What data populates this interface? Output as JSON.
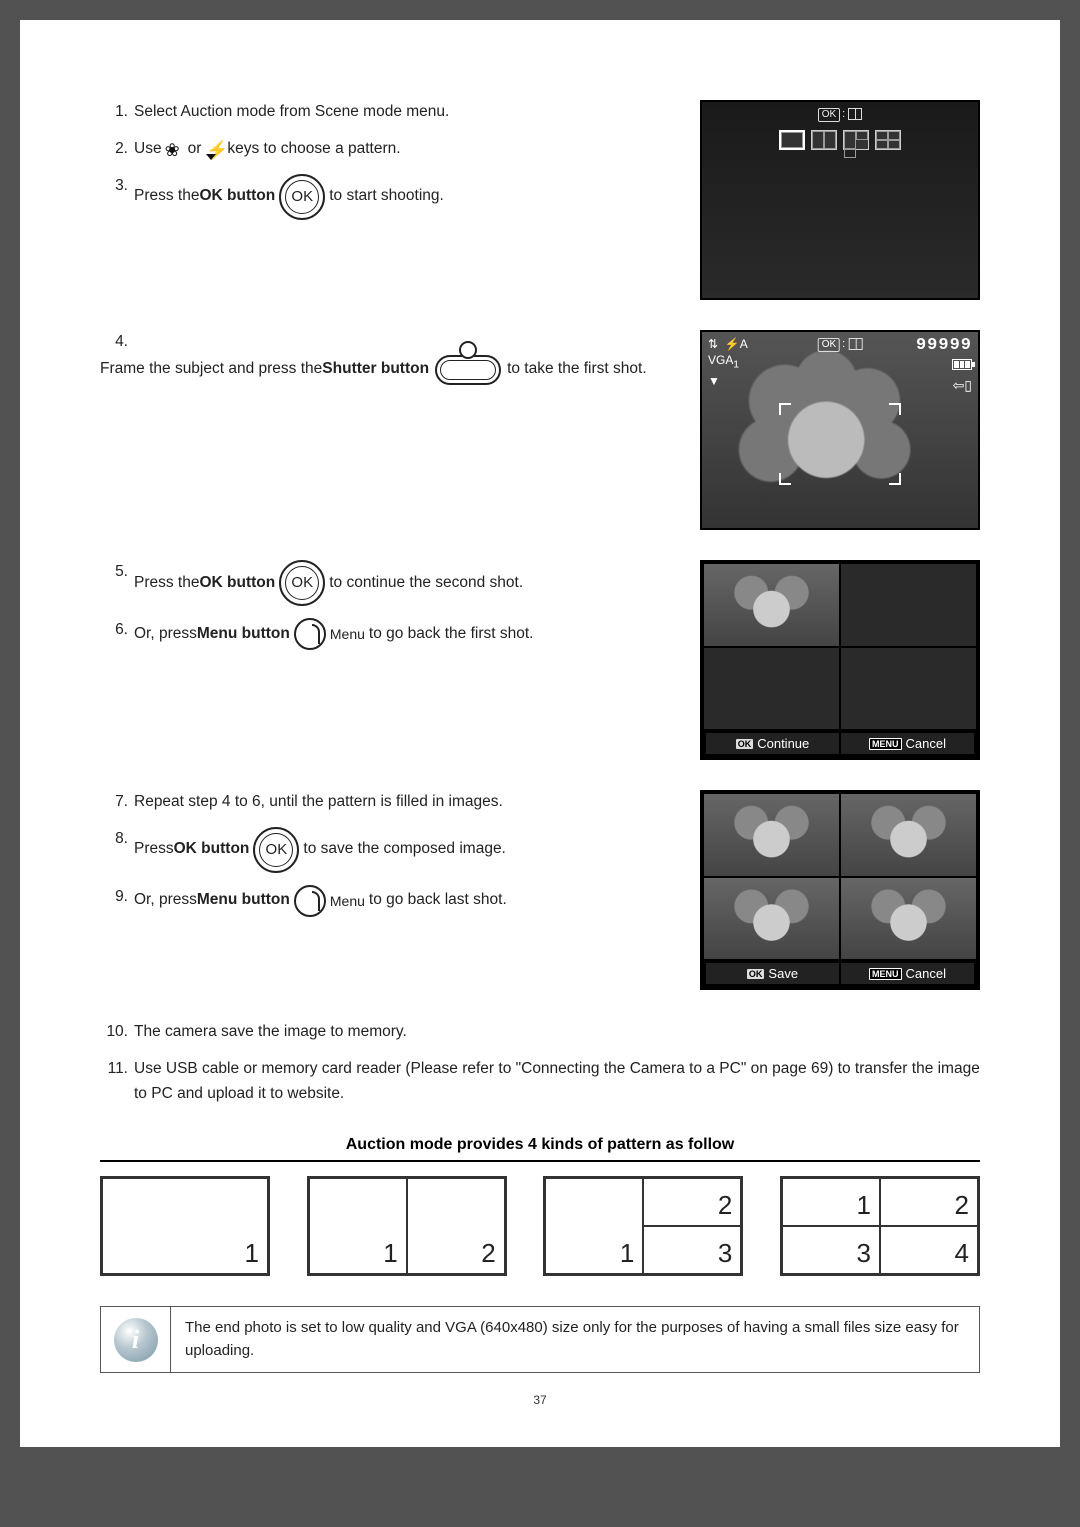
{
  "steps": {
    "s1": {
      "num": "1.",
      "text": "Select Auction mode from Scene mode menu."
    },
    "s2": {
      "num": "2.",
      "t1": "Use ",
      "t2": " or ",
      "t3": " keys to choose a pattern."
    },
    "s3": {
      "num": "3.",
      "t1": "Press the ",
      "bold": "OK button",
      "ok": "OK",
      "t2": " to start shooting."
    },
    "s4": {
      "num": "4.",
      "t1": "Frame the subject and press the ",
      "bold": "Shutter button",
      "t2": " to take the first shot."
    },
    "s5": {
      "num": "5.",
      "t1": "Press the ",
      "bold": "OK button",
      "ok": "OK",
      "t2": " to continue the second shot."
    },
    "s6": {
      "num": "6.",
      "t1": "Or, press ",
      "bold": "Menu button",
      "menu": "Menu",
      "t2": " to go back the first shot."
    },
    "s7": {
      "num": "7.",
      "text": "Repeat step 4 to 6, until the pattern is filled in images."
    },
    "s8": {
      "num": "8.",
      "t1": "Press ",
      "bold": "OK button",
      "ok": "OK",
      "t2": " to save the composed image."
    },
    "s9": {
      "num": "9.",
      "t1": "Or, press ",
      "bold": "Menu button",
      "menu": "Menu",
      "t2": " to go back last shot."
    },
    "s10": {
      "num": "10.",
      "text": "The camera save the image to memory."
    },
    "s11": {
      "num": "11.",
      "text": "Use USB cable or memory card reader (Please refer to \"Connecting the Camera to a PC\" on page 69) to transfer the image to PC and upload it to website."
    }
  },
  "screen1": {
    "ok": "OK",
    "colon": ":"
  },
  "screen2": {
    "flash": "⚡",
    "flashA": "A",
    "ok": "OK",
    "colon": ":",
    "vga": "VGA",
    "vga_sub": "1",
    "count": "99999",
    "exposure_icon": "⇅",
    "down": "▼"
  },
  "screen3": {
    "ok_tag": "OK",
    "continue": "Continue",
    "menu_tag": "MENU",
    "cancel": "Cancel"
  },
  "screen4": {
    "ok_tag": "OK",
    "save": "Save",
    "menu_tag": "MENU",
    "cancel": "Cancel"
  },
  "patternTitle": "Auction mode provides 4 kinds of pattern as follow",
  "patterns": {
    "p1": [
      "1"
    ],
    "p2": [
      "1",
      "2"
    ],
    "p3": [
      "1",
      "2",
      "3"
    ],
    "p4": [
      "1",
      "2",
      "3",
      "4"
    ]
  },
  "note": {
    "icon": "i",
    "text": "The end photo is set to low quality and VGA (640x480) size only for the purposes of having a small files size easy for uploading."
  },
  "pageNumber": "37"
}
